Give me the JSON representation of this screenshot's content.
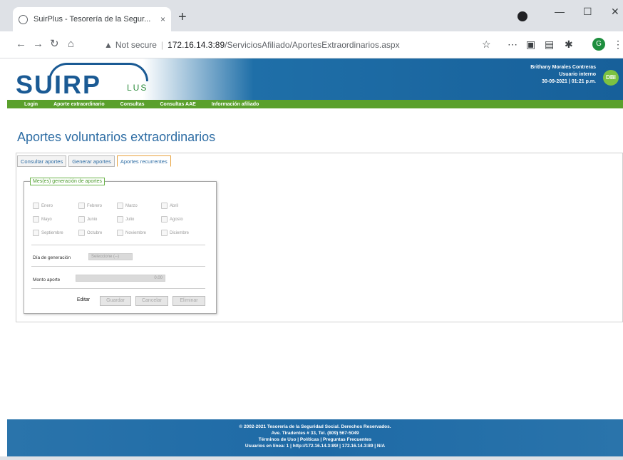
{
  "browser": {
    "tab_title": "SuirPlus - Tesorería de la Segur...",
    "tab_close": "×",
    "new_tab": "+",
    "url_warning": "Not secure",
    "url_host": "172.16.14.3:89",
    "url_path": "/ServiciosAfiliado/AportesExtraordinarios.aspx",
    "profile_initial": "G",
    "icons": [
      "back-arrow-icon",
      "forward-arrow-icon",
      "reload-icon",
      "home-icon",
      "star-icon",
      "extensions-icon",
      "window-minimize-icon",
      "window-maximize-icon",
      "window-close-icon"
    ]
  },
  "header": {
    "logo_word": "SUIRP",
    "logo_sub": "LUS",
    "user_name": "Brithany Morales Contreras",
    "user_role": "Usuario interno",
    "user_datetime": "30-09-2021 | 01:21 p.m.",
    "user_badge": "DBI"
  },
  "menu": {
    "items": [
      "Login",
      "Aporte extraordinario",
      "Consultas",
      "Consultas AAE",
      "Información afiliado"
    ]
  },
  "page": {
    "title": "Aportes voluntarios extraordinarios",
    "tabs": [
      "Consultar aportes",
      "Generar aportes",
      "Aportes recurrentes"
    ],
    "active_tab": 2
  },
  "panel": {
    "legend": "Mes(es) generación de aportes",
    "months": [
      [
        "Enero",
        "Febrero",
        "Marzo",
        "Abril"
      ],
      [
        "Mayo",
        "Junio",
        "Julio",
        "Agosto"
      ],
      [
        "Septiembre",
        "Octubre",
        "Noviembre",
        "Diciembre"
      ]
    ],
    "day_label": "Día de generación",
    "day_value": "Seleccione (--)",
    "amount_label": "Monto aporte",
    "amount_value": "0.00",
    "buttons": {
      "edit": "Editar",
      "save": "Guardar",
      "cancel": "Cancelar",
      "delete": "Eliminar"
    }
  },
  "footer": {
    "line1": "© 2002-2021 Tesorería de la Seguridad Social. Derechos Reservados.",
    "line2": "Ave. Tiradentes # 33, Tel. (809) 567-5049",
    "line3": "Términos de Uso | Políticas | Preguntas Frecuentes",
    "line4": "Usuarios en línea: 1 | http://172.16.14.3:89/ | 172.16.14.3:89 | N/A"
  }
}
